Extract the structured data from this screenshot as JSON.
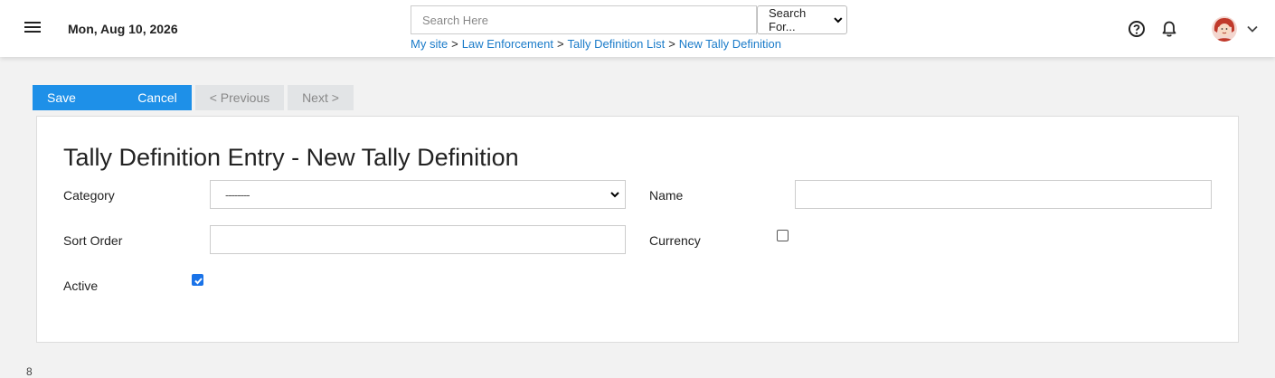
{
  "header": {
    "date": "Mon, Aug 10, 2026",
    "search": {
      "placeholder": "Search Here",
      "value": ""
    },
    "search_scope": "Search For...",
    "breadcrumb": [
      {
        "label": "My site"
      },
      {
        "label": "Law Enforcement"
      },
      {
        "label": "Tally Definition List"
      },
      {
        "label": "New Tally Definition"
      }
    ],
    "breadcrumb_separator": ">",
    "icons": [
      "menu-icon",
      "help-icon",
      "bell-icon",
      "chevron-down-icon"
    ]
  },
  "toolbar": {
    "save_label": "Save",
    "cancel_label": "Cancel",
    "previous_label": "< Previous",
    "next_label": "Next >"
  },
  "form": {
    "title": "Tally Definition Entry - New Tally Definition",
    "category": {
      "label": "Category",
      "value": "--------"
    },
    "name": {
      "label": "Name",
      "value": ""
    },
    "sort_order": {
      "label": "Sort Order",
      "value": ""
    },
    "currency": {
      "label": "Currency",
      "checked": false
    },
    "active": {
      "label": "Active",
      "checked": true
    }
  },
  "colors": {
    "accent": "#1e90e8",
    "link": "#1a7bc9",
    "disabled_button": "#e2e4e6",
    "page_background": "#f2f2f2"
  },
  "footer_fragment": "8"
}
